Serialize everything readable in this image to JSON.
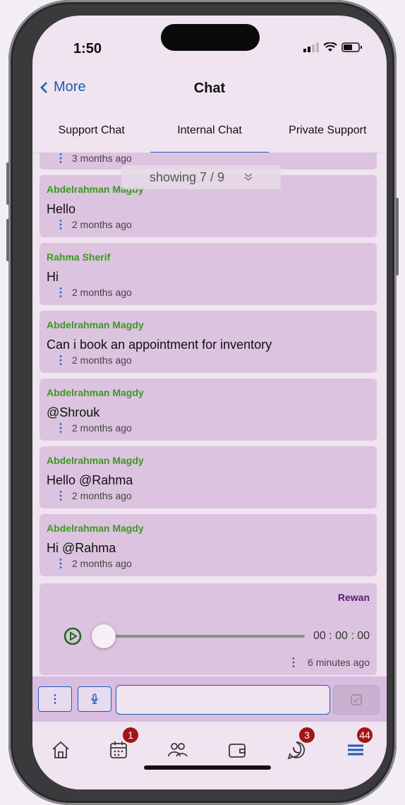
{
  "status_bar": {
    "time": "1:50"
  },
  "header": {
    "back_label": "More",
    "title": "Chat"
  },
  "tabs": [
    {
      "label": "Support Chat",
      "active": false
    },
    {
      "label": "Internal Chat",
      "active": true
    },
    {
      "label": "Private Support",
      "active": false
    }
  ],
  "pager": {
    "text": "showing 7 / 9"
  },
  "messages": [
    {
      "time": "3 months ago"
    },
    {
      "sender": "Abdelrahman Magdy",
      "text": "Hello",
      "time": "2 months ago"
    },
    {
      "sender": "Rahma Sherif",
      "text": "Hi",
      "time": "2 months ago"
    },
    {
      "sender": "Abdelrahman Magdy",
      "text": "Can i book an appointment for inventory",
      "time": "2 months ago"
    },
    {
      "sender": "Abdelrahman Magdy",
      "text": "@Shrouk",
      "time": "2 months ago"
    },
    {
      "sender": "Abdelrahman Magdy",
      "text": "Hello @Rahma",
      "time": "2 months ago"
    },
    {
      "sender": "Abdelrahman Magdy",
      "text": "Hi @Rahma",
      "time": "2 months ago"
    }
  ],
  "voice_message": {
    "sender": "Rewan",
    "duration": "00 : 00 : 00",
    "time": "6 minutes ago",
    "progress": 0
  },
  "composer": {
    "placeholder": ""
  },
  "nav": {
    "badges": {
      "calendar": "1",
      "whatsapp": "3",
      "menu": "44"
    }
  },
  "colors": {
    "accent": "#1d5bb8",
    "sender": "#3a9a1e",
    "bubble": "#dcc3df",
    "badge": "#a31515",
    "voice_sender": "#5a1a7a"
  }
}
